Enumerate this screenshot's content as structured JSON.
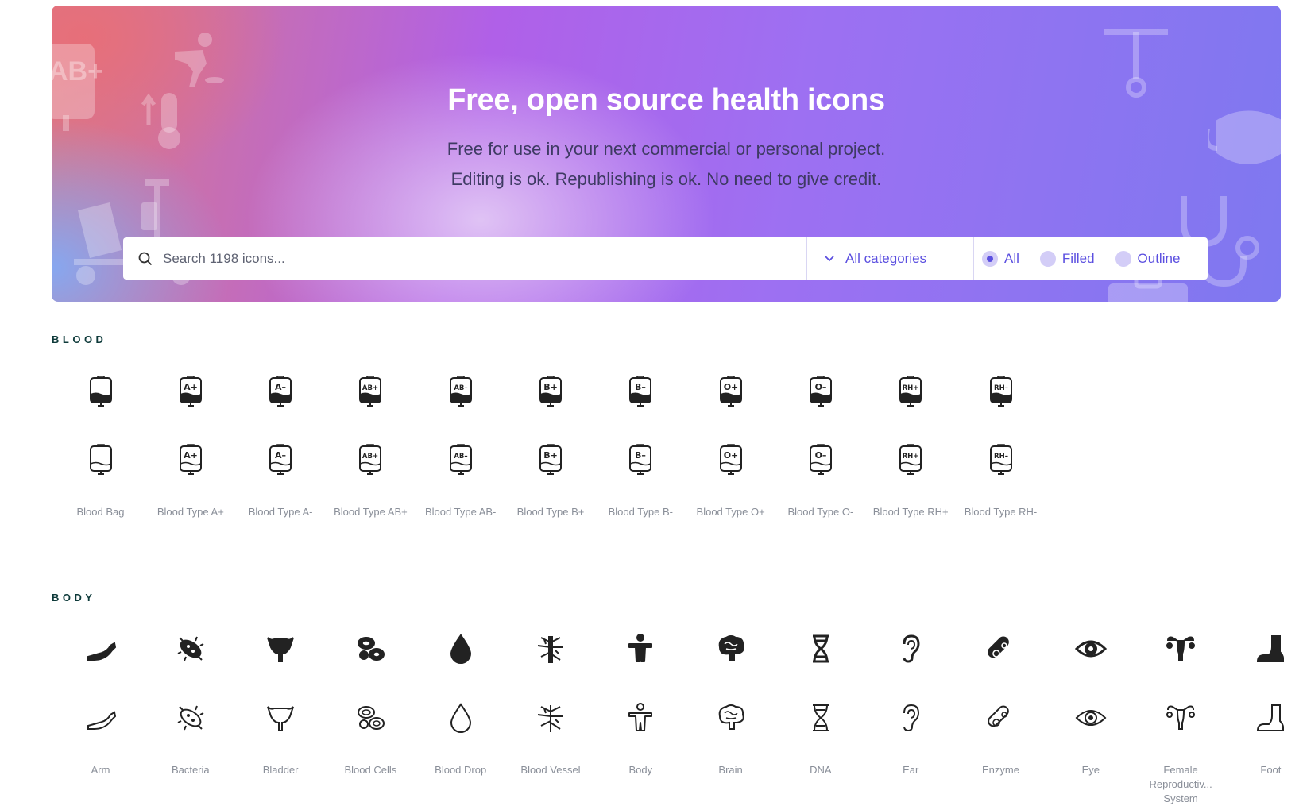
{
  "hero": {
    "title": "Free, open source health icons",
    "subtitle_line1": "Free for use in your next commercial or personal project.",
    "subtitle_line2": "Editing is ok. Republishing is ok. No need to give credit.",
    "decorative_icons": [
      "blood-type-ab-plus-icon",
      "person-vomiting-icon",
      "thermometer-rising-icon",
      "iv-stand-icon",
      "corkscrew-icon",
      "face-mask-icon",
      "stethoscope-icon",
      "medical-bag-icon"
    ]
  },
  "search": {
    "placeholder": "Search 1198 icons...",
    "category_label": "All categories",
    "filters": [
      {
        "label": "All",
        "selected": true
      },
      {
        "label": "Filled",
        "selected": false
      },
      {
        "label": "Outline",
        "selected": false
      }
    ]
  },
  "colors": {
    "accent": "#5b4fe0",
    "section_title": "#0e3a3a",
    "label": "#8a8f99",
    "icon": "#222222"
  },
  "sections": [
    {
      "title": "BLOOD",
      "icons": [
        {
          "name": "Blood Bag",
          "code": ""
        },
        {
          "name": "Blood Type A+",
          "code": "A+"
        },
        {
          "name": "Blood Type A-",
          "code": "A–"
        },
        {
          "name": "Blood Type AB+",
          "code": "AB+"
        },
        {
          "name": "Blood Type AB-",
          "code": "AB–"
        },
        {
          "name": "Blood Type B+",
          "code": "B+"
        },
        {
          "name": "Blood Type B-",
          "code": "B–"
        },
        {
          "name": "Blood Type O+",
          "code": "O+"
        },
        {
          "name": "Blood Type O-",
          "code": "O–"
        },
        {
          "name": "Blood Type RH+",
          "code": "RH+"
        },
        {
          "name": "Blood Type RH-",
          "code": "RH–"
        }
      ]
    },
    {
      "title": "BODY",
      "icons": [
        {
          "name": "Arm",
          "icon": "arm-icon"
        },
        {
          "name": "Bacteria",
          "icon": "bacteria-icon"
        },
        {
          "name": "Bladder",
          "icon": "bladder-icon"
        },
        {
          "name": "Blood Cells",
          "icon": "blood-cells-icon"
        },
        {
          "name": "Blood Drop",
          "icon": "blood-drop-icon"
        },
        {
          "name": "Blood Vessel",
          "icon": "blood-vessel-icon"
        },
        {
          "name": "Body",
          "icon": "body-icon"
        },
        {
          "name": "Brain",
          "icon": "brain-icon"
        },
        {
          "name": "DNA",
          "icon": "dna-icon"
        },
        {
          "name": "Ear",
          "icon": "ear-icon"
        },
        {
          "name": "Enzyme",
          "icon": "enzyme-icon"
        },
        {
          "name": "Eye",
          "icon": "eye-icon"
        },
        {
          "name": "Female Reproductiv... System",
          "icon": "female-reproductive-system-icon"
        },
        {
          "name": "Foot",
          "icon": "foot-icon"
        }
      ]
    }
  ]
}
